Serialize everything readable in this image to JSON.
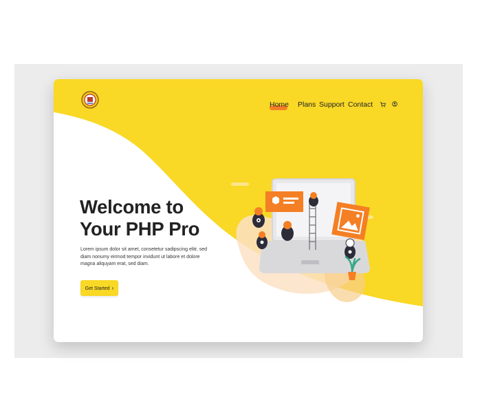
{
  "colors": {
    "accent_yellow": "#f9d826",
    "accent_orange": "#f47f24",
    "text_dark": "#222222"
  },
  "nav": {
    "items": [
      {
        "label": "Home",
        "active": true
      },
      {
        "label": "Plans"
      },
      {
        "label": "Support"
      },
      {
        "label": "Contact"
      }
    ],
    "icons": [
      "cart-icon",
      "user-icon"
    ]
  },
  "hero": {
    "title_line1": "Welcome to",
    "title_line2": "Your PHP Pro",
    "body": "Lorem ipsum dolor sit amet, consetetur sadipscing elitr, sed diam nonumy eirmod tempor invidunt ut labore et dolore magna aliquyam erat, sed diam.",
    "cta_label": "Get Started",
    "cta_icon": "chevron-right-icon"
  },
  "illustration": "website-builders-laptop-illustration",
  "logo_icon": "brand-logo-icon"
}
